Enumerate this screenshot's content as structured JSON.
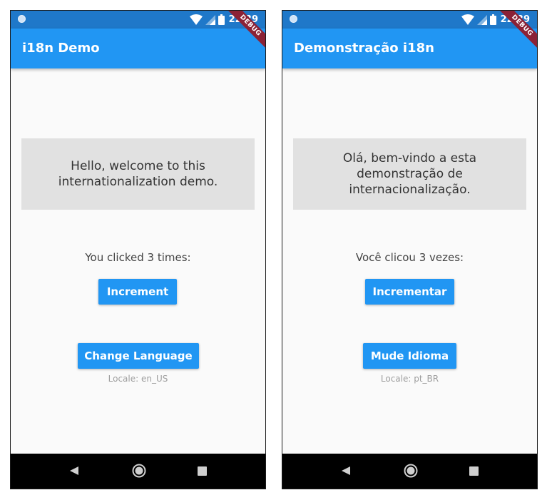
{
  "colors": {
    "status_bar": "#1f78c9",
    "app_bar": "#2196f3",
    "button": "#2196f3",
    "card": "#e1e1e1",
    "debug_banner": "#8b2236",
    "nav_bar": "#000000"
  },
  "icons": {
    "status": [
      "notification-dot-icon",
      "wifi-icon",
      "signal-icon",
      "battery-icon"
    ],
    "navigation": [
      "back-triangle-icon",
      "home-circle-icon",
      "recent-apps-square-icon"
    ]
  },
  "screens": [
    {
      "status_time": "22:39",
      "debug_label": "DEBUG",
      "app_title": "i18n Demo",
      "greeting": "Hello, welcome to this internationalization demo.",
      "counter_text": "You clicked 3 times:",
      "increment_label": "Increment",
      "change_language_label": "Change Language",
      "locale_text": "Locale: en_US"
    },
    {
      "status_time": "22:39",
      "debug_label": "DEBUG",
      "app_title": "Demonstração i18n",
      "greeting": "Olá, bem-vindo a esta demonstração de internacionalização.",
      "counter_text": "Você clicou 3 vezes:",
      "increment_label": "Incrementar",
      "change_language_label": "Mude Idioma",
      "locale_text": "Locale: pt_BR"
    }
  ]
}
